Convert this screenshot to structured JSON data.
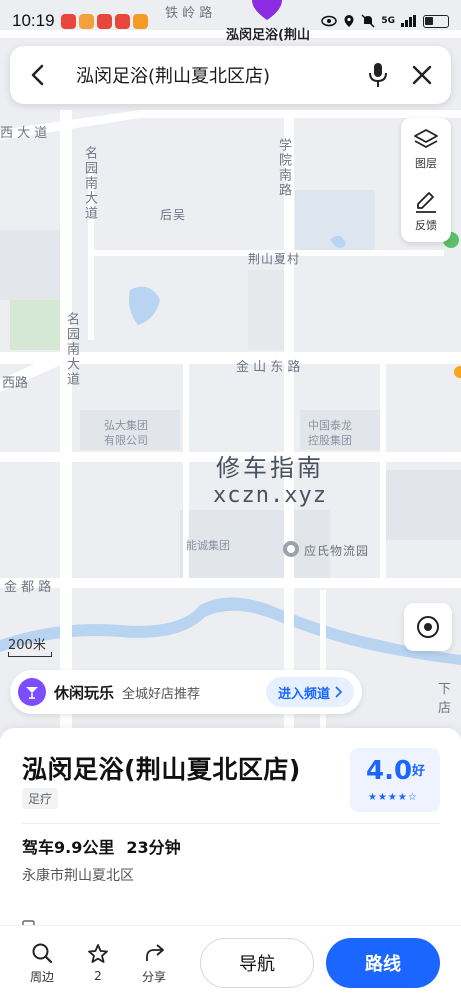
{
  "status_bar": {
    "time": "10:19",
    "network": "5G"
  },
  "search": {
    "query": "泓闵足浴(荆山夏北区店)"
  },
  "map": {
    "pin_label": "泓闵足浴(荆山",
    "roads": {
      "tieling": "铁 岭 路",
      "xida": "西 大 道",
      "mingyuan_upper": "名园南大道",
      "mingyuan_lower": "名园南大道",
      "xueyuan": "学院南路",
      "jinshan_east": "金 山 东 路",
      "xi": "西路",
      "jindu": "金 都 路",
      "xia": "下店"
    },
    "places": {
      "houwu": "后吴",
      "jingshan_xia": "荆山夏村",
      "hongda": "弘大集团\n有限公司",
      "zhongguo_tailong": "中国泰龙\n控股集团",
      "nengcheng": "能诚集团",
      "yingshi": "应氏物流园"
    },
    "watermark_line1": "修车指南",
    "watermark_line2": "xczn.xyz",
    "scale_label": "200米"
  },
  "tools": {
    "layers_label": "图层",
    "feedback_label": "反馈"
  },
  "promo": {
    "title": "休闲玩乐",
    "subtitle": "全城好店推荐",
    "button_label": "进入频道"
  },
  "place": {
    "name": "泓闵足浴(荆山夏北区店)",
    "category": "足疗",
    "rating": "4.0",
    "rating_word": "好",
    "rating_stars": "★★★★☆",
    "drive_distance": "驾车9.9公里",
    "drive_time": "23分钟",
    "address": "永康市荆山夏北区"
  },
  "actions": {
    "nearby_label": "周边",
    "favorite_count": "2",
    "share_label": "分享",
    "navigate_label": "导航",
    "route_label": "路线"
  },
  "colors": {
    "accent": "#1a66ff",
    "map_bg": "#eceef1",
    "road": "#ffffff",
    "water": "#b8d4f0",
    "green": "#d5e8d4",
    "promo_icon": "#7c4dff"
  }
}
